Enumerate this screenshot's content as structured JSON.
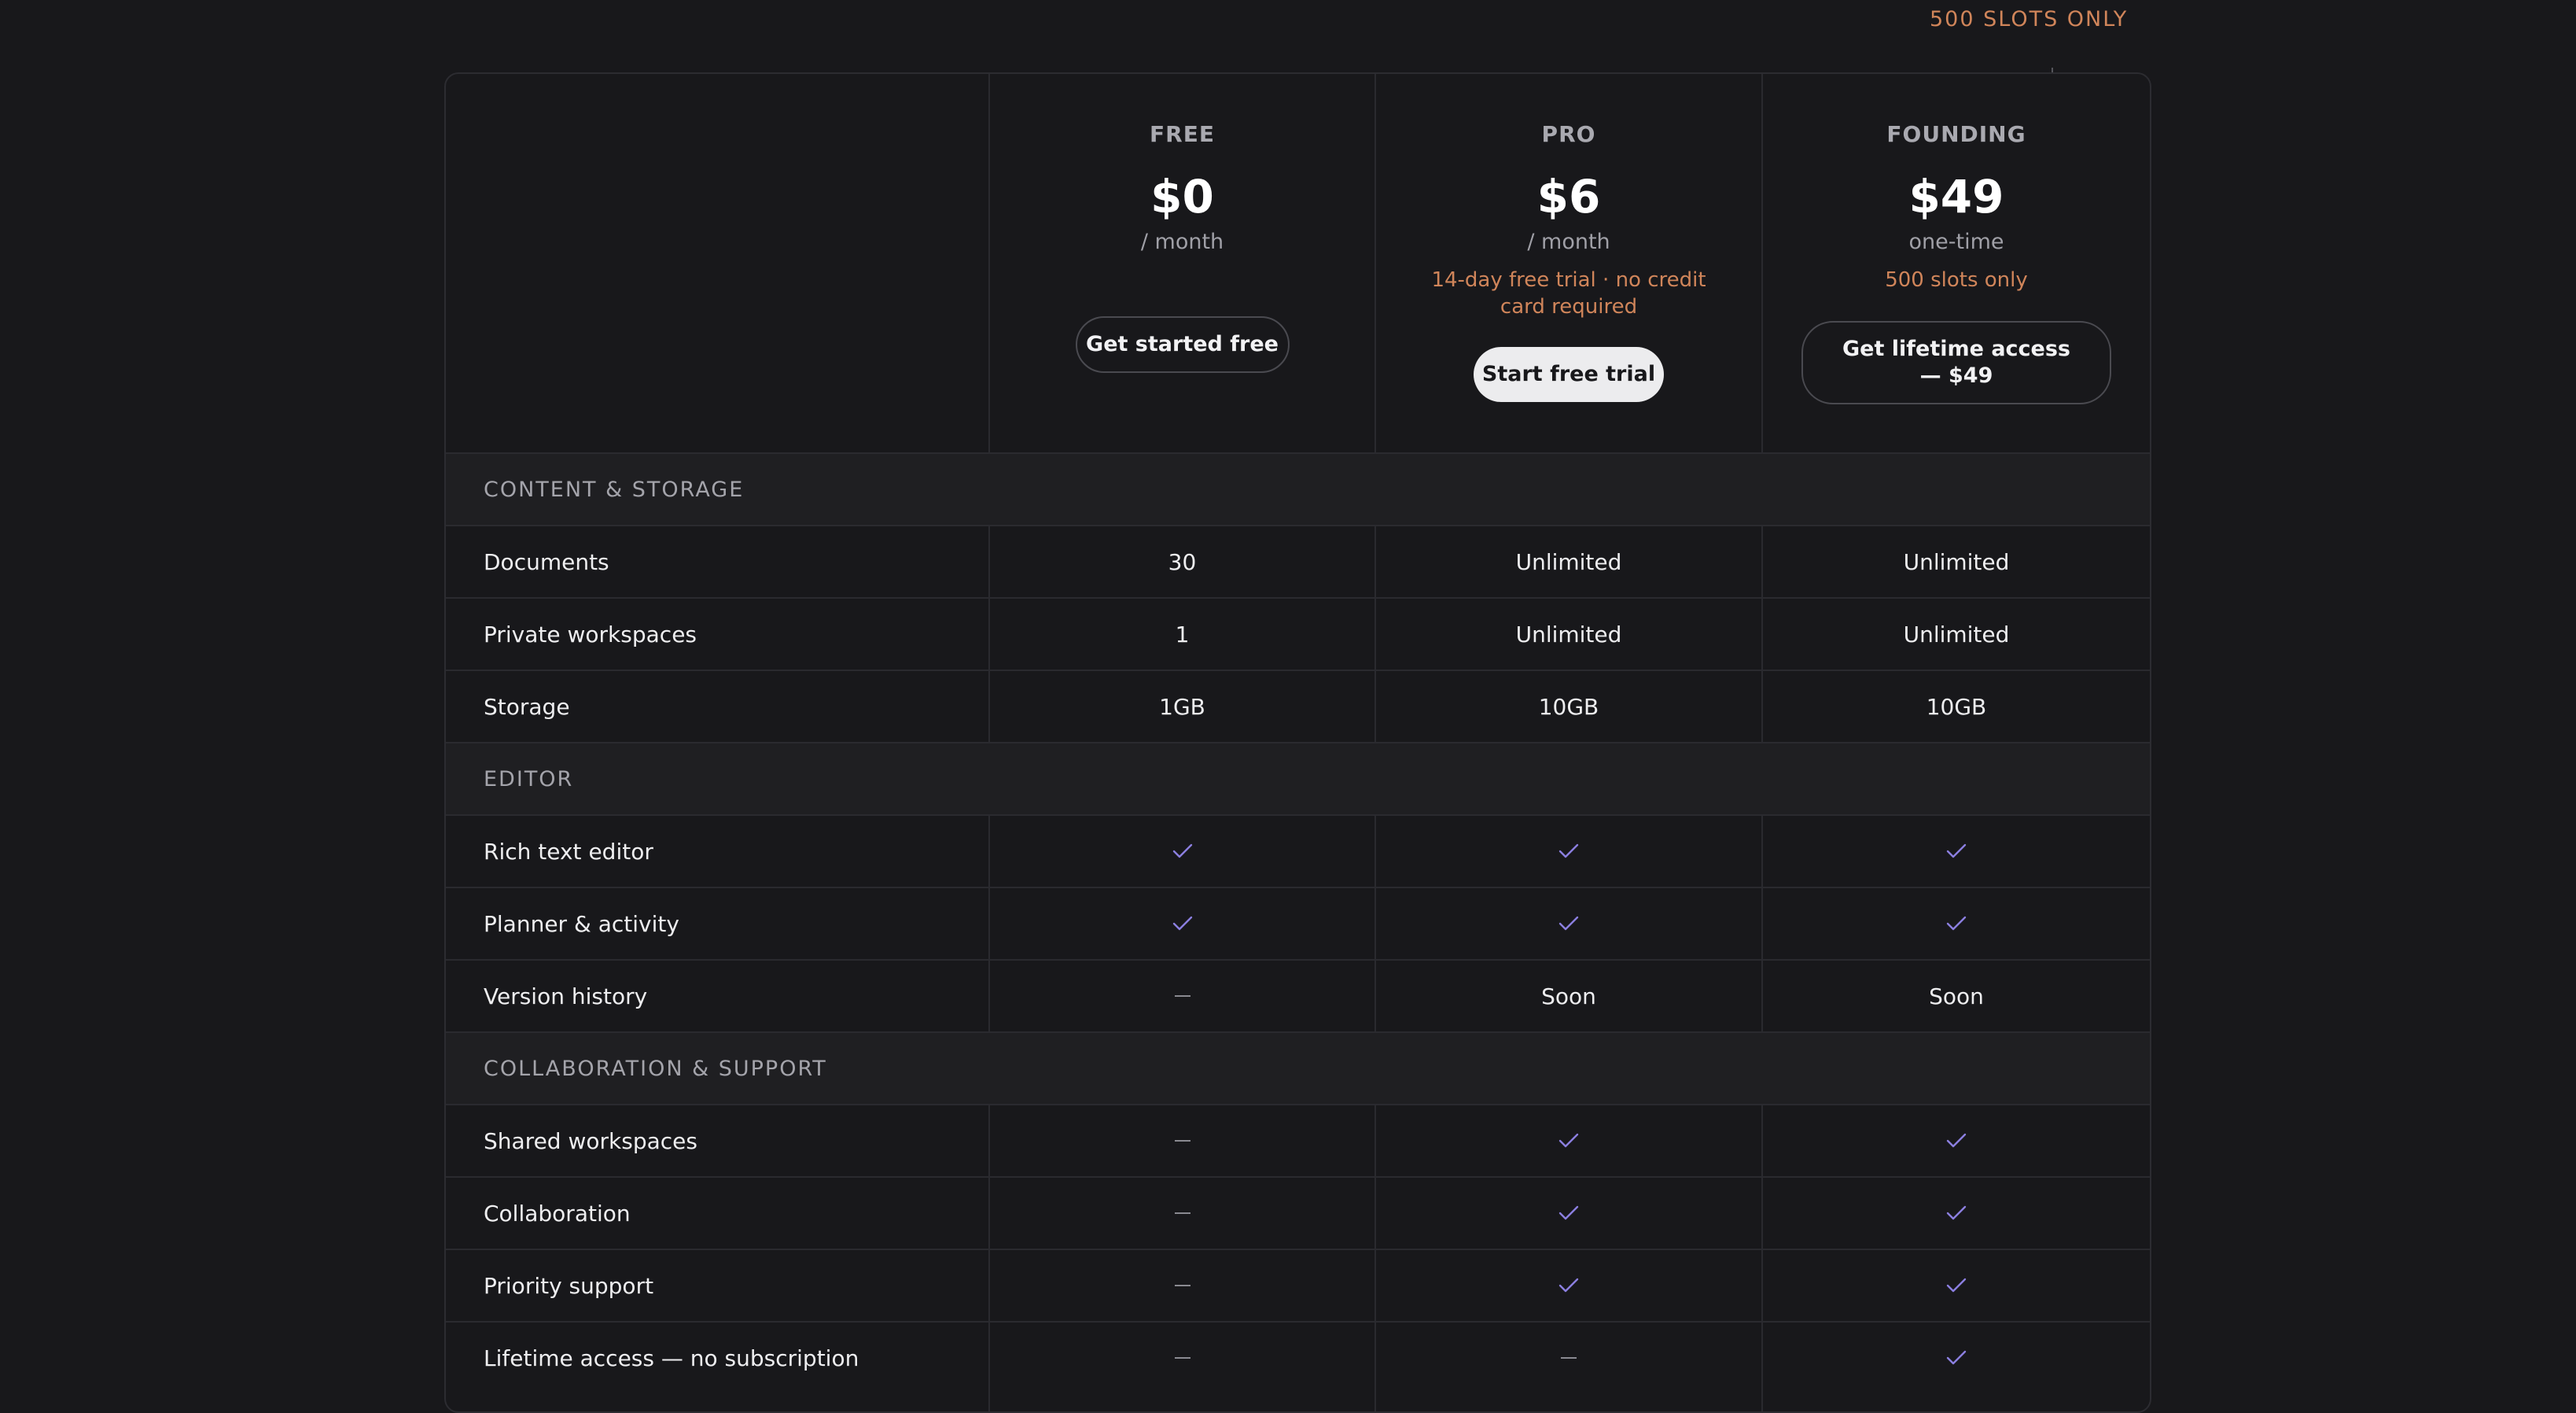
{
  "badge": "500 SLOTS ONLY",
  "plans": [
    {
      "name": "FREE",
      "price": "$0",
      "period": "/ month",
      "note": "",
      "button": "Get started free",
      "button_style": "outline"
    },
    {
      "name": "PRO",
      "price": "$6",
      "period": "/ month",
      "note": "14-day free trial · no credit card required",
      "button": "Start free trial",
      "button_style": "solid"
    },
    {
      "name": "FOUNDING",
      "price": "$49",
      "period": "one-time",
      "note": "500 slots only",
      "button": "Get lifetime access — $49",
      "button_style": "outline"
    }
  ],
  "rows": [
    {
      "type": "section",
      "label": "CONTENT & STORAGE"
    },
    {
      "type": "feature",
      "label": "Documents",
      "values": [
        "30",
        "Unlimited",
        "Unlimited"
      ]
    },
    {
      "type": "feature",
      "label": "Private workspaces",
      "values": [
        "1",
        "Unlimited",
        "Unlimited"
      ]
    },
    {
      "type": "feature",
      "label": "Storage",
      "values": [
        "1GB",
        "10GB",
        "10GB"
      ]
    },
    {
      "type": "section",
      "label": "EDITOR"
    },
    {
      "type": "feature",
      "label": "Rich text editor",
      "values": [
        "check",
        "check",
        "check"
      ]
    },
    {
      "type": "feature",
      "label": "Planner & activity",
      "values": [
        "check",
        "check",
        "check"
      ]
    },
    {
      "type": "feature",
      "label": "Version history",
      "values": [
        "dash",
        "Soon",
        "Soon"
      ]
    },
    {
      "type": "section",
      "label": "COLLABORATION & SUPPORT"
    },
    {
      "type": "feature",
      "label": "Shared workspaces",
      "values": [
        "dash",
        "check",
        "check"
      ]
    },
    {
      "type": "feature",
      "label": "Collaboration",
      "values": [
        "dash",
        "check",
        "check"
      ]
    },
    {
      "type": "feature",
      "label": "Priority support",
      "values": [
        "dash",
        "check",
        "check"
      ]
    },
    {
      "type": "feature",
      "label": "Lifetime access — no subscription",
      "values": [
        "dash",
        "dash",
        "check"
      ]
    }
  ],
  "icons": {
    "check": "check-icon",
    "dash": "dash-icon"
  },
  "colors": {
    "accent": "#d0855a",
    "check": "#8b7fe0",
    "background": "#18181b"
  }
}
